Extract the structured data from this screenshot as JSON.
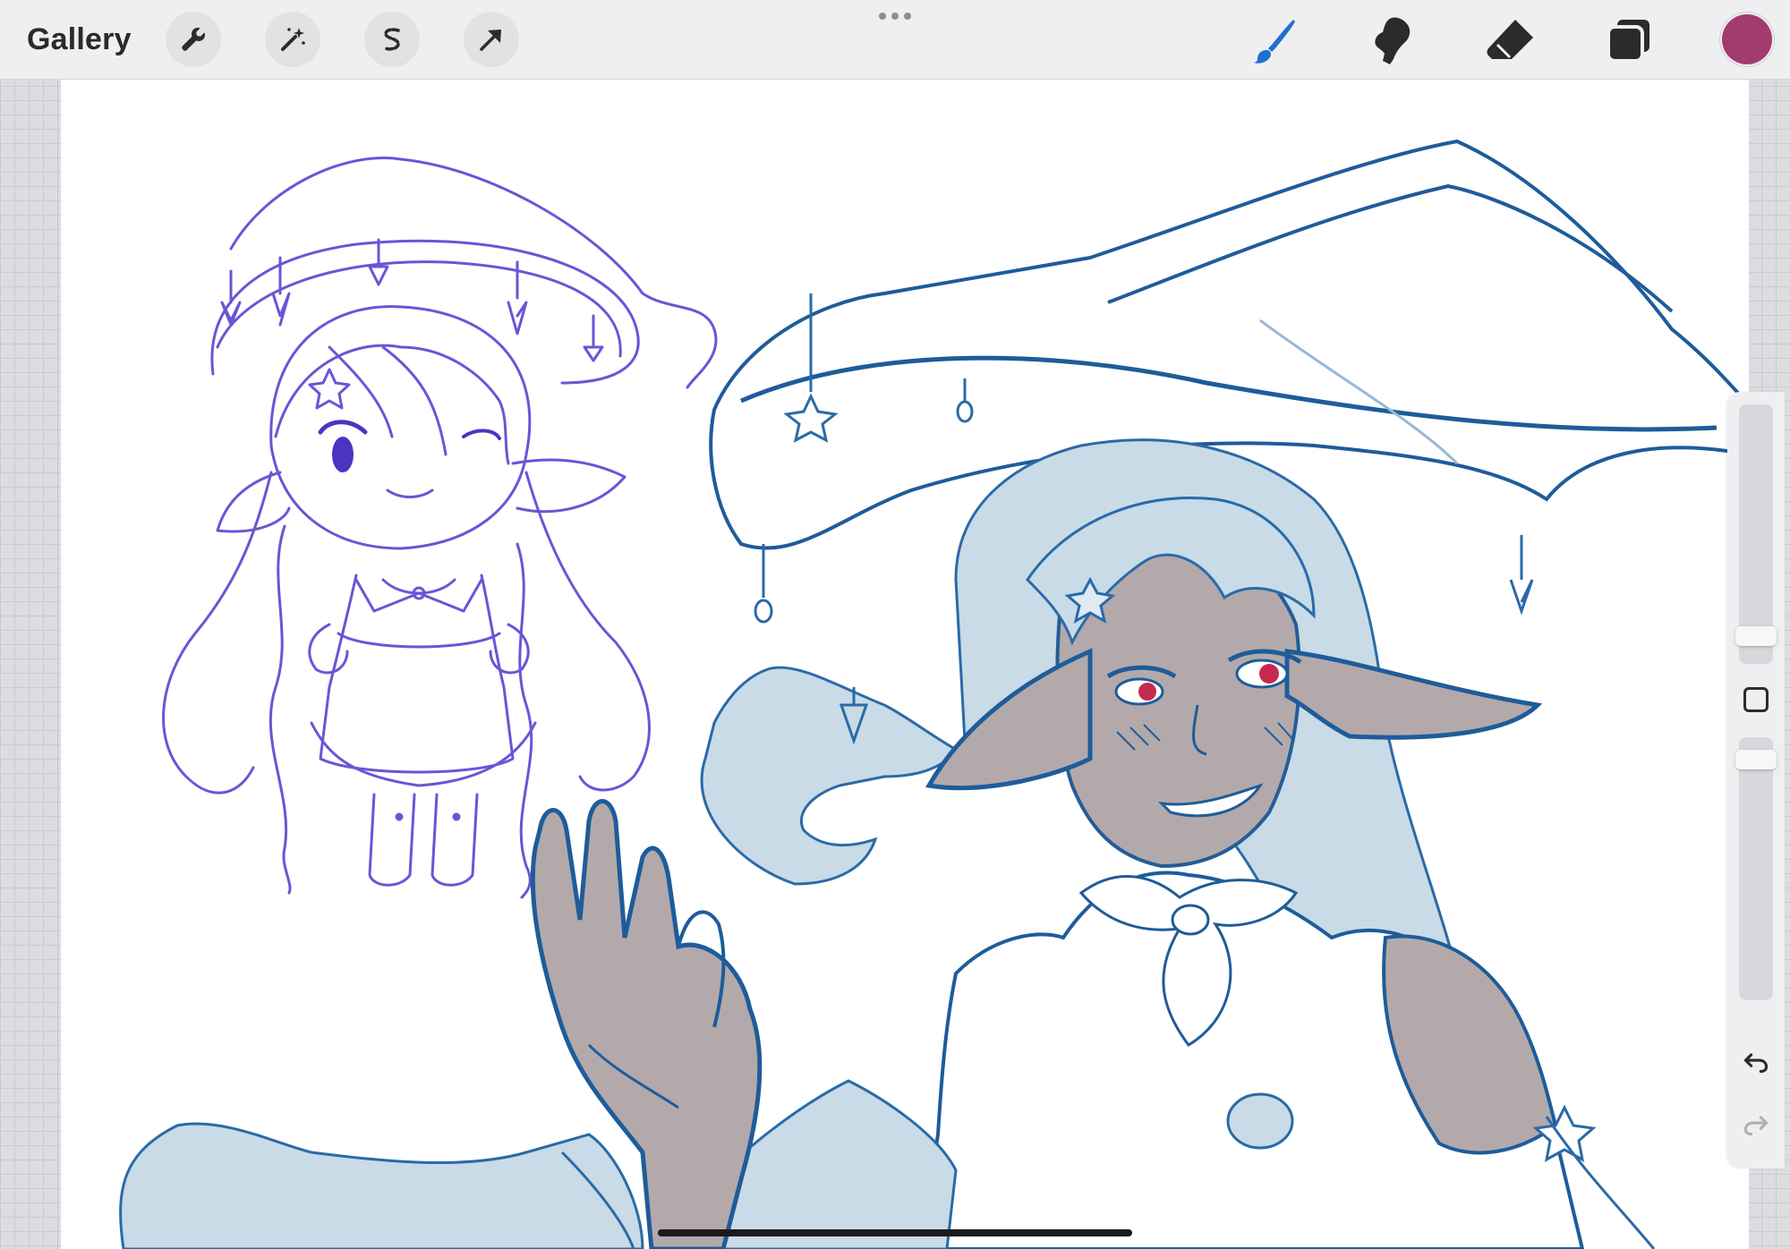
{
  "app": {
    "gallery_label": "Gallery"
  },
  "toolbar": {
    "left_tools": [
      {
        "name": "actions",
        "icon": "wrench-icon"
      },
      {
        "name": "adjustments",
        "icon": "magic-wand-icon"
      },
      {
        "name": "selection",
        "icon": "selection-s-icon"
      },
      {
        "name": "transform",
        "icon": "arrow-cursor-icon"
      }
    ],
    "right_tools": [
      {
        "name": "brush",
        "icon": "brush-icon",
        "active": true
      },
      {
        "name": "smudge",
        "icon": "smudge-finger-icon"
      },
      {
        "name": "eraser",
        "icon": "eraser-icon"
      },
      {
        "name": "layers",
        "icon": "layers-icon"
      }
    ],
    "current_color": "#a23b6e",
    "accent_color": "#1f6fd1"
  },
  "sidebar": {
    "brush_size": 0.09,
    "opacity": 0.95
  }
}
